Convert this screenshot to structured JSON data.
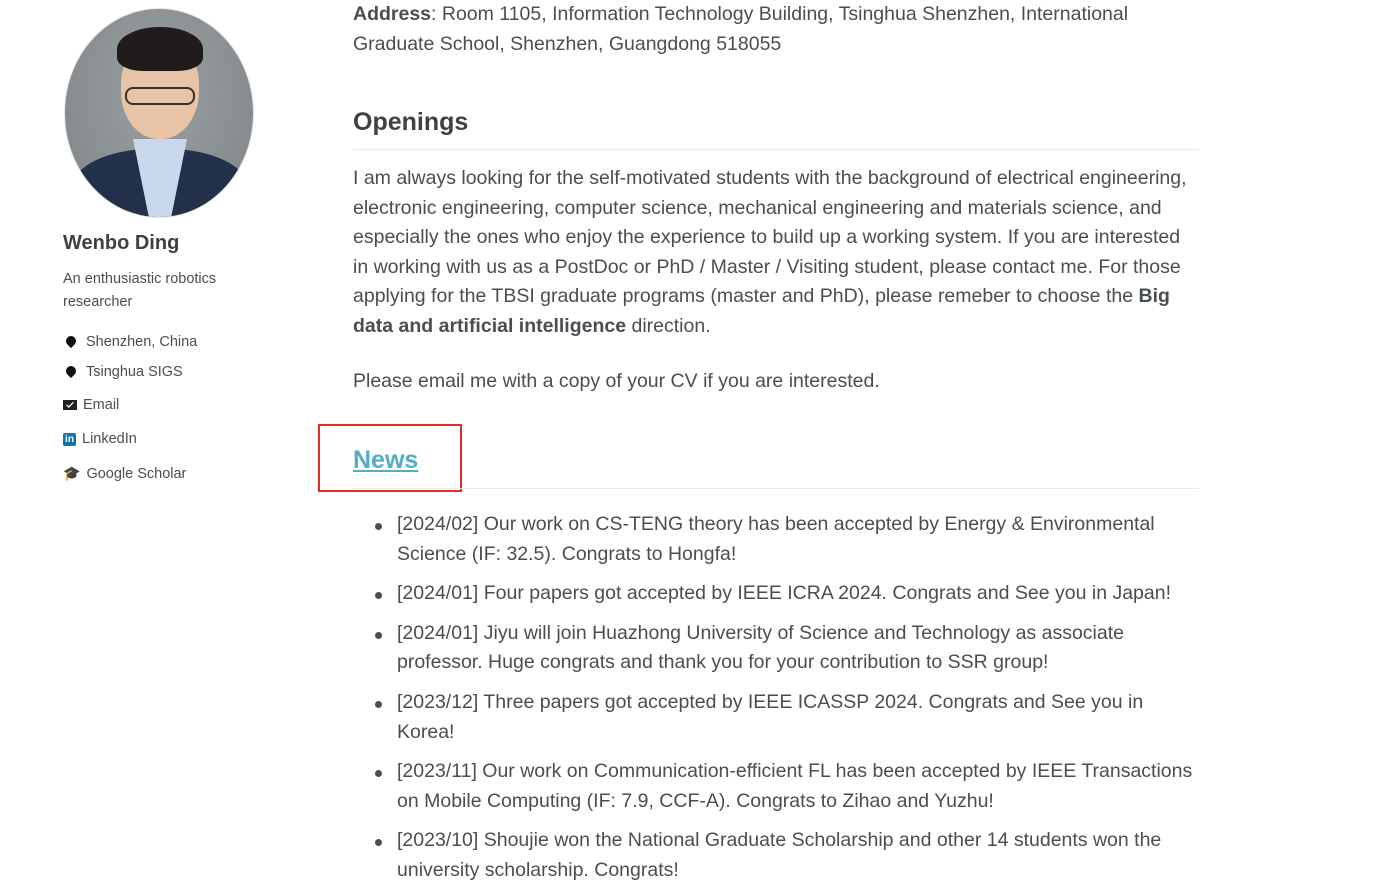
{
  "profile": {
    "name": "Wenbo Ding",
    "bio": "An enthusiastic robotics researcher",
    "links": [
      {
        "icon": "location-pin-icon",
        "label": "Shenzhen, China"
      },
      {
        "icon": "location-pin-icon",
        "label": "Tsinghua SIGS"
      },
      {
        "icon": "envelope-icon",
        "label": "Email"
      },
      {
        "icon": "linkedin-icon",
        "label": "LinkedIn"
      },
      {
        "icon": "graduation-cap-icon",
        "label": "Google Scholar"
      }
    ]
  },
  "address": {
    "label": "Address",
    "value": ": Room 1105, Information Technology Building, Tsinghua Shenzhen, International Graduate School, Shenzhen, Guangdong 518055"
  },
  "openings": {
    "title": "Openings",
    "paragraph_start": "I am always looking for the self-motivated students with the background of electrical engineering, electronic engineering, computer science, mechanical engineering and materials science, and especially the ones who enjoy the experience to build up a working system. If you are interested in working with us as a PostDoc or PhD / Master / Visiting student, please contact me. For those applying for the TBSI graduate programs (master and PhD), please remeber to choose the ",
    "bold": "Big data and artificial intelligence",
    "paragraph_end": " direction.",
    "email_note": "Please email me with a copy of your CV if you are interested."
  },
  "news": {
    "title": "News",
    "items": [
      "[2024/02] Our work on CS-TENG theory has been accepted by Energy & Environmental Science (IF: 32.5). Congrats to Hongfa!",
      "[2024/01] Four papers got accepted by IEEE ICRA 2024. Congrats and See you in Japan!",
      "[2024/01] Jiyu will join Huazhong University of Science and Technology as associate professor. Huge congrats and thank you for your contribution to SSR group!",
      "[2023/12] Three papers got accepted by IEEE ICASSP 2024. Congrats and See you in Korea!",
      "[2023/11] Our work on Communication-efficient FL has been accepted by IEEE Transactions on Mobile Computing (IF: 7.9, CCF-A). Congrats to Zihao and Yuzhu!",
      "[2023/10] Shoujie won the National Graduate Scholarship and other 14 students won the university scholarship. Congrats!"
    ]
  },
  "colors": {
    "link": "#52adc8",
    "highlight_box": "#e32d23",
    "text": "#494e52",
    "heading": "#3d4144"
  }
}
